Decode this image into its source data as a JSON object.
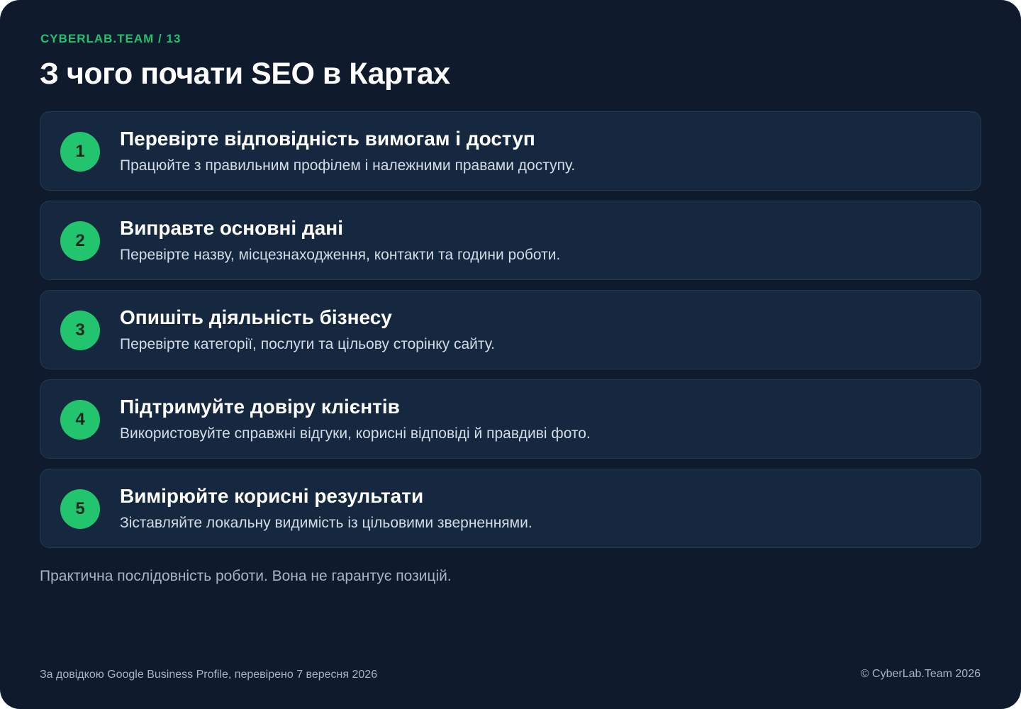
{
  "header": {
    "eyebrow": "CYBERLAB.TEAM / 13",
    "title": "З чого почати SEO в Картах"
  },
  "steps": [
    {
      "number": "1",
      "title": "Перевірте відповідність вимогам і доступ",
      "description": "Працюйте з правильним профілем і належними правами доступу."
    },
    {
      "number": "2",
      "title": "Виправте основні дані",
      "description": "Перевірте назву, місцезнаходження, контакти та години роботи."
    },
    {
      "number": "3",
      "title": "Опишіть діяльність бізнесу",
      "description": "Перевірте категорії, послуги та цільову сторінку сайту."
    },
    {
      "number": "4",
      "title": "Підтримуйте довіру клієнтів",
      "description": "Використовуйте справжні відгуки, корисні відповіді й правдиві фото."
    },
    {
      "number": "5",
      "title": "Вимірюйте корисні результати",
      "description": "Зіставляйте локальну видимість із цільовими зверненнями."
    }
  ],
  "note": "Практична послідовність роботи. Вона не гарантує позицій.",
  "footer": {
    "source": "За довідкою Google Business Profile, перевірено 7 вересня 2026",
    "copyright": "© CyberLab.Team  2026"
  },
  "colors": {
    "background": "#0f1b2c",
    "card": "#152840",
    "accent": "#22c56d"
  }
}
